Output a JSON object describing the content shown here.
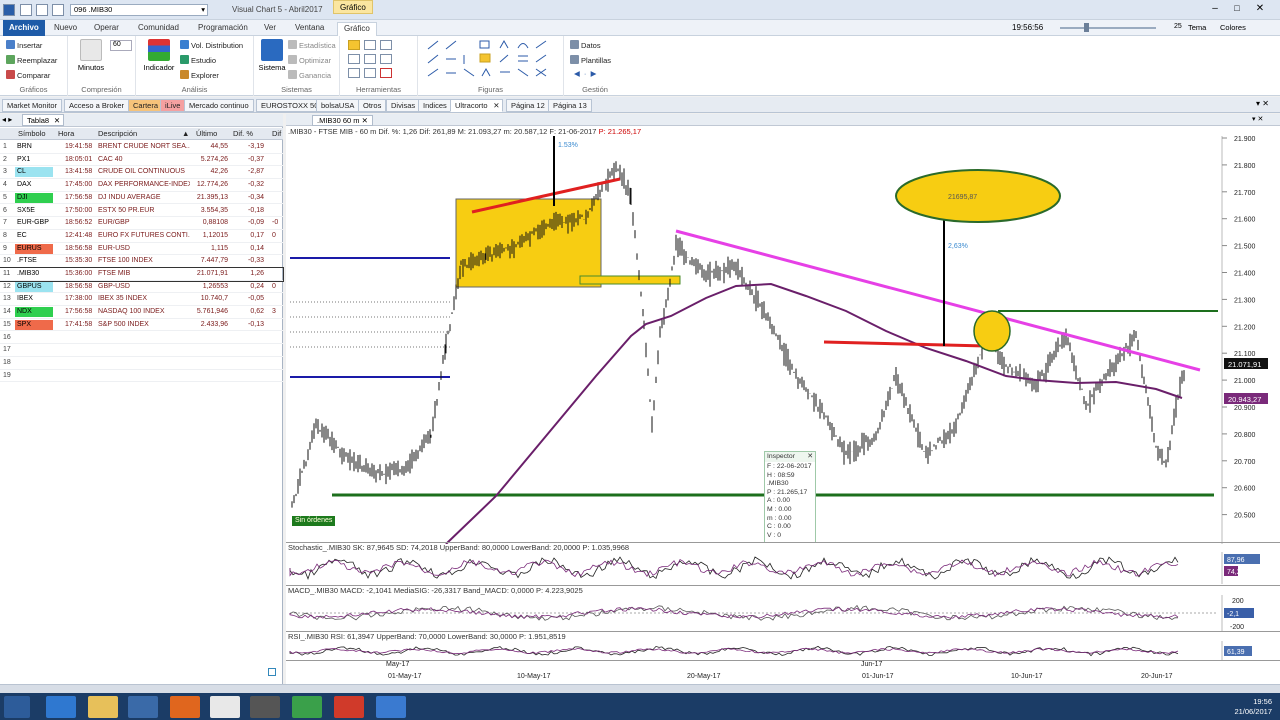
{
  "titlebar": {
    "workspace": "096 .MIB30",
    "app_title": "Visual Chart 5 - Abril2017",
    "context_tab": "Gráfico"
  },
  "ribbon_tabs": [
    "Archivo",
    "Nuevo",
    "Operar",
    "Comunidad",
    "Programación",
    "Ver",
    "Ventana",
    "Gráfico"
  ],
  "right_header": {
    "clock": "19:56:56",
    "zoom": "25",
    "tema": "Tema",
    "colores": "Colores"
  },
  "ribbon": {
    "graficos": {
      "label": "Gráficos",
      "items": [
        "Insertar",
        "Reemplazar",
        "Comparar"
      ]
    },
    "compresion": {
      "label": "Compresión",
      "minutos": "Minutos",
      "value": "60"
    },
    "analisis": {
      "label": "Análisis",
      "indicador": "Indicador",
      "items": [
        "Vol. Distribution",
        "Estudio",
        "Explorer"
      ]
    },
    "sistemas": {
      "label": "Sistemas",
      "sistema": "Sistema",
      "items": [
        "Estadística",
        "Optimizar",
        "Ganancia"
      ]
    },
    "herramientas": {
      "label": "Herramientas"
    },
    "figuras": {
      "label": "Figuras"
    },
    "gestion": {
      "label": "Gestión",
      "items": [
        "Datos",
        "Plantillas"
      ]
    }
  },
  "workspace_tabs": [
    "Market Monitor",
    "Acceso a Broker",
    "Cartera",
    "iLive",
    "Mercado continuo",
    "EUROSTOXX 50",
    "bolsaUSA",
    "Otros",
    "Divisas",
    "Indices",
    "Ultracorto",
    "Página 12",
    "Página 13"
  ],
  "left_panel": {
    "tab": "Tabla8",
    "columns": [
      "Símbolo",
      "Hora",
      "Descripción",
      "Último",
      "Dif. %",
      "Dif"
    ],
    "rows": [
      {
        "n": "1",
        "sym": "BRN",
        "hora": "19:41:58",
        "desc": "BRENT CRUDE NORT SEA...",
        "last": "44,55",
        "dif": "-3,19",
        "x": "",
        "color": "#ffffff"
      },
      {
        "n": "2",
        "sym": "PX1",
        "hora": "18:05:01",
        "desc": "CAC 40",
        "last": "5.274,26",
        "dif": "-0,37",
        "x": "",
        "color": "#ffffff"
      },
      {
        "n": "3",
        "sym": "CL",
        "hora": "13:41:58",
        "desc": "CRUDE OIL CONTINUOUS",
        "last": "42,26",
        "dif": "-2,87",
        "x": "",
        "color": "#9be3f0"
      },
      {
        "n": "4",
        "sym": "DAX",
        "hora": "17:45:00",
        "desc": "DAX PERFORMANCE-INDEX",
        "last": "12.774,26",
        "dif": "-0,32",
        "x": "",
        "color": "#ffffff"
      },
      {
        "n": "5",
        "sym": "DJI",
        "hora": "17:56:58",
        "desc": "DJ INDU AVERAGE",
        "last": "21.395,13",
        "dif": "-0,34",
        "x": "",
        "color": "#2fcf4f"
      },
      {
        "n": "6",
        "sym": "SX5E",
        "hora": "17:50:00",
        "desc": "ESTX 50 PR.EUR",
        "last": "3.554,35",
        "dif": "-0,18",
        "x": "",
        "color": "#ffffff"
      },
      {
        "n": "7",
        "sym": "EUR-GBP",
        "hora": "18:56:52",
        "desc": "EUR/GBP",
        "last": "0,88108",
        "dif": "-0,09",
        "x": "-0",
        "color": "#ffffff"
      },
      {
        "n": "8",
        "sym": "EC",
        "hora": "12:41:48",
        "desc": "EURO FX FUTURES CONTI...",
        "last": "1,12015",
        "dif": "0,17",
        "x": "0",
        "color": "#ffffff"
      },
      {
        "n": "9",
        "sym": "EURUS",
        "hora": "18:56:58",
        "desc": "EUR-USD",
        "last": "1,115",
        "dif": "0,14",
        "x": "",
        "color": "#ef6a4a"
      },
      {
        "n": "10",
        "sym": ".FTSE",
        "hora": "15:35:30",
        "desc": "FTSE 100 INDEX",
        "last": "7.447,79",
        "dif": "-0,33",
        "x": "",
        "color": "#ffffff"
      },
      {
        "n": "11",
        "sym": ".MIB30",
        "hora": "15:36:00",
        "desc": "FTSE MIB",
        "last": "21.071,91",
        "dif": "1,26",
        "x": "",
        "color": "#ffffff"
      },
      {
        "n": "12",
        "sym": "GBPUS",
        "hora": "18:56:58",
        "desc": "GBP-USD",
        "last": "1,26553",
        "dif": "0,24",
        "x": "0",
        "color": "#9be3f0"
      },
      {
        "n": "13",
        "sym": "IBEX",
        "hora": "17:38:00",
        "desc": "IBEX 35 INDEX",
        "last": "10.740,7",
        "dif": "-0,05",
        "x": "",
        "color": "#ffffff"
      },
      {
        "n": "14",
        "sym": "NDX",
        "hora": "17:56:58",
        "desc": "NASDAQ 100 INDEX",
        "last": "5.761,946",
        "dif": "0,62",
        "x": "3",
        "color": "#2fcf4f"
      },
      {
        "n": "15",
        "sym": "SPX",
        "hora": "17:41:58",
        "desc": "S&P 500 INDEX",
        "last": "2.433,96",
        "dif": "-0,13",
        "x": "",
        "color": "#ef6a4a"
      },
      {
        "n": "16",
        "sym": "",
        "hora": "",
        "desc": "",
        "last": "",
        "dif": "",
        "x": "",
        "color": "#ffffff"
      },
      {
        "n": "17",
        "sym": "",
        "hora": "",
        "desc": "",
        "last": "",
        "dif": "",
        "x": "",
        "color": "#ffffff"
      },
      {
        "n": "18",
        "sym": "",
        "hora": "",
        "desc": "",
        "last": "",
        "dif": "",
        "x": "",
        "color": "#ffffff"
      },
      {
        "n": "19",
        "sym": "",
        "hora": "",
        "desc": "",
        "last": "",
        "dif": "",
        "x": "",
        "color": "#ffffff"
      }
    ]
  },
  "chart": {
    "tab": ".MIB30 60 m",
    "header": ".MIB30 - FTSE MIB - 60 m  Dif. %: 1,26  Dif: 261,89  M: 21.093,27  m: 20.587,12  F: 21-06-2017",
    "header_price": "P: 21.265,17",
    "price_axis": [
      "21.900",
      "21.800",
      "21.700",
      "21.600",
      "21.500",
      "21.400",
      "21.300",
      "21.200",
      "21.100",
      "21.000",
      "20.900",
      "20.800",
      "20.700",
      "20.600",
      "20.500"
    ],
    "last_price": "21.071,91",
    "ma_price": "20.943,27",
    "annotations": {
      "pct_top": "1.53%",
      "ellipse_value": "21695,87",
      "pct_mid": "2,63%",
      "sin_ordenes": "Sin órdenes"
    },
    "inspector": {
      "title": "Inspector",
      "lines": [
        "F  : 22-06-2017",
        "H  : 08:59",
        ".MIB30",
        "P  : 21.265,17",
        "A  : 0.00",
        "M  : 0.00",
        "m  : 0.00",
        "C  : 0.00",
        "V  : 0"
      ]
    },
    "stochastic": {
      "header": "Stochastic_.MIB30 SK: 87,9645  SD: 74,2018  UpperBand: 80,0000  LowerBand: 20,0000  P: 1.035,9968",
      "v1": "87,96",
      "v2": "74,2"
    },
    "macd": {
      "header": "MACD_.MIB30 MACD: -2,1041  MediaSIG: -26,3317  Band_MACD: 0,0000  P: 4.223,9025",
      "axis": [
        "200",
        "-200"
      ],
      "v1": "-2,1"
    },
    "rsi": {
      "header": "RSI_.MIB30 RSI: 61,3947  UpperBand: 70,0000  LowerBand: 30,0000  P: 1.951,8519",
      "v1": "61,39"
    },
    "time_axis_top": [
      "May-17",
      "Jun-17"
    ],
    "time_axis": [
      "01-May-17",
      "10-May-17",
      "20-May-17",
      "01-Jun-17",
      "10-Jun-17",
      "20-Jun-17"
    ]
  },
  "taskbar": {
    "time": "19:56",
    "date": "21/06/2017"
  }
}
